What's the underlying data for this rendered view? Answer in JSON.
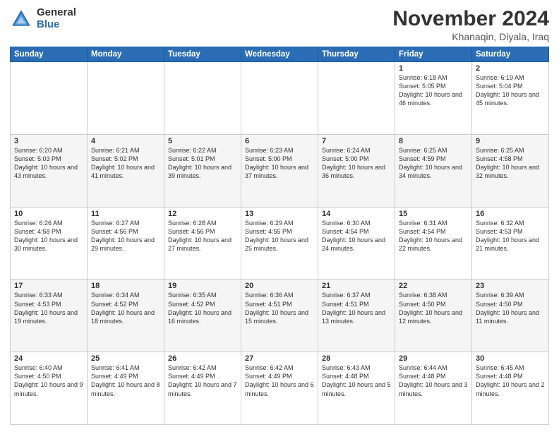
{
  "logo": {
    "general": "General",
    "blue": "Blue"
  },
  "title": "November 2024",
  "location": "Khanaqin, Diyala, Iraq",
  "days_of_week": [
    "Sunday",
    "Monday",
    "Tuesday",
    "Wednesday",
    "Thursday",
    "Friday",
    "Saturday"
  ],
  "weeks": [
    [
      {
        "day": "",
        "info": ""
      },
      {
        "day": "",
        "info": ""
      },
      {
        "day": "",
        "info": ""
      },
      {
        "day": "",
        "info": ""
      },
      {
        "day": "",
        "info": ""
      },
      {
        "day": "1",
        "info": "Sunrise: 6:18 AM\nSunset: 5:05 PM\nDaylight: 10 hours and 46 minutes."
      },
      {
        "day": "2",
        "info": "Sunrise: 6:19 AM\nSunset: 5:04 PM\nDaylight: 10 hours and 45 minutes."
      }
    ],
    [
      {
        "day": "3",
        "info": "Sunrise: 6:20 AM\nSunset: 5:03 PM\nDaylight: 10 hours and 43 minutes."
      },
      {
        "day": "4",
        "info": "Sunrise: 6:21 AM\nSunset: 5:02 PM\nDaylight: 10 hours and 41 minutes."
      },
      {
        "day": "5",
        "info": "Sunrise: 6:22 AM\nSunset: 5:01 PM\nDaylight: 10 hours and 39 minutes."
      },
      {
        "day": "6",
        "info": "Sunrise: 6:23 AM\nSunset: 5:00 PM\nDaylight: 10 hours and 37 minutes."
      },
      {
        "day": "7",
        "info": "Sunrise: 6:24 AM\nSunset: 5:00 PM\nDaylight: 10 hours and 36 minutes."
      },
      {
        "day": "8",
        "info": "Sunrise: 6:25 AM\nSunset: 4:59 PM\nDaylight: 10 hours and 34 minutes."
      },
      {
        "day": "9",
        "info": "Sunrise: 6:25 AM\nSunset: 4:58 PM\nDaylight: 10 hours and 32 minutes."
      }
    ],
    [
      {
        "day": "10",
        "info": "Sunrise: 6:26 AM\nSunset: 4:58 PM\nDaylight: 10 hours and 30 minutes."
      },
      {
        "day": "11",
        "info": "Sunrise: 6:27 AM\nSunset: 4:56 PM\nDaylight: 10 hours and 29 minutes."
      },
      {
        "day": "12",
        "info": "Sunrise: 6:28 AM\nSunset: 4:56 PM\nDaylight: 10 hours and 27 minutes."
      },
      {
        "day": "13",
        "info": "Sunrise: 6:29 AM\nSunset: 4:55 PM\nDaylight: 10 hours and 25 minutes."
      },
      {
        "day": "14",
        "info": "Sunrise: 6:30 AM\nSunset: 4:54 PM\nDaylight: 10 hours and 24 minutes."
      },
      {
        "day": "15",
        "info": "Sunrise: 6:31 AM\nSunset: 4:54 PM\nDaylight: 10 hours and 22 minutes."
      },
      {
        "day": "16",
        "info": "Sunrise: 6:32 AM\nSunset: 4:53 PM\nDaylight: 10 hours and 21 minutes."
      }
    ],
    [
      {
        "day": "17",
        "info": "Sunrise: 6:33 AM\nSunset: 4:53 PM\nDaylight: 10 hours and 19 minutes."
      },
      {
        "day": "18",
        "info": "Sunrise: 6:34 AM\nSunset: 4:52 PM\nDaylight: 10 hours and 18 minutes."
      },
      {
        "day": "19",
        "info": "Sunrise: 6:35 AM\nSunset: 4:52 PM\nDaylight: 10 hours and 16 minutes."
      },
      {
        "day": "20",
        "info": "Sunrise: 6:36 AM\nSunset: 4:51 PM\nDaylight: 10 hours and 15 minutes."
      },
      {
        "day": "21",
        "info": "Sunrise: 6:37 AM\nSunset: 4:51 PM\nDaylight: 10 hours and 13 minutes."
      },
      {
        "day": "22",
        "info": "Sunrise: 6:38 AM\nSunset: 4:50 PM\nDaylight: 10 hours and 12 minutes."
      },
      {
        "day": "23",
        "info": "Sunrise: 6:39 AM\nSunset: 4:50 PM\nDaylight: 10 hours and 11 minutes."
      }
    ],
    [
      {
        "day": "24",
        "info": "Sunrise: 6:40 AM\nSunset: 4:50 PM\nDaylight: 10 hours and 9 minutes."
      },
      {
        "day": "25",
        "info": "Sunrise: 6:41 AM\nSunset: 4:49 PM\nDaylight: 10 hours and 8 minutes."
      },
      {
        "day": "26",
        "info": "Sunrise: 6:42 AM\nSunset: 4:49 PM\nDaylight: 10 hours and 7 minutes."
      },
      {
        "day": "27",
        "info": "Sunrise: 6:42 AM\nSunset: 4:49 PM\nDaylight: 10 hours and 6 minutes."
      },
      {
        "day": "28",
        "info": "Sunrise: 6:43 AM\nSunset: 4:48 PM\nDaylight: 10 hours and 5 minutes."
      },
      {
        "day": "29",
        "info": "Sunrise: 6:44 AM\nSunset: 4:48 PM\nDaylight: 10 hours and 3 minutes."
      },
      {
        "day": "30",
        "info": "Sunrise: 6:45 AM\nSunset: 4:48 PM\nDaylight: 10 hours and 2 minutes."
      }
    ]
  ]
}
